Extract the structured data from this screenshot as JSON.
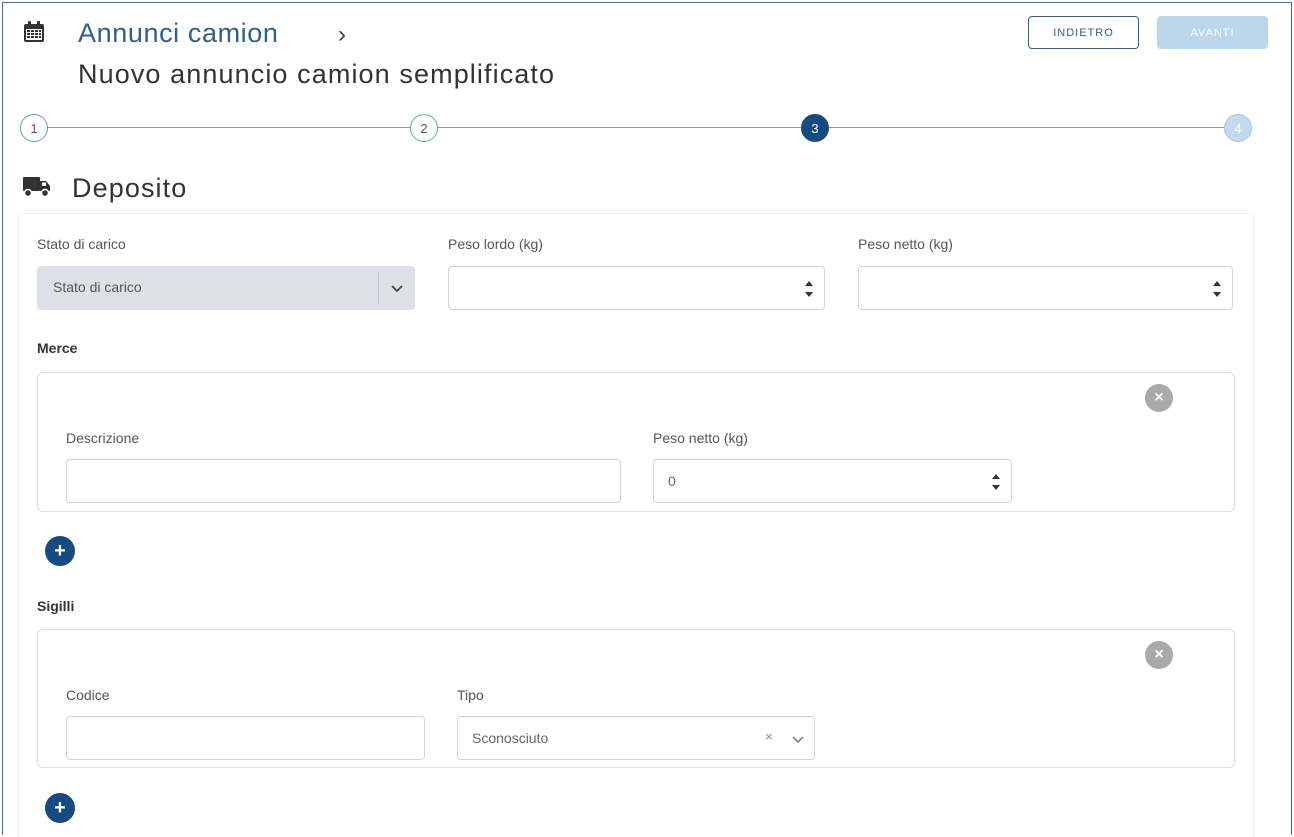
{
  "header": {
    "breadcrumb_label": "Annunci camion",
    "breadcrumb_separator": "›",
    "page_title": "Nuovo annuncio camion semplificato",
    "back_label": "INDIETRO",
    "next_label": "AVANTI"
  },
  "stepper": {
    "steps": [
      "1",
      "2",
      "3",
      "4"
    ],
    "current_step": 3
  },
  "section": {
    "title": "Deposito"
  },
  "form": {
    "stato_label": "Stato di carico",
    "stato_value": "Stato di carico",
    "peso_lordo_label": "Peso lordo (kg)",
    "peso_lordo_value": "",
    "peso_netto_label": "Peso netto (kg)",
    "peso_netto_value": ""
  },
  "merce": {
    "title": "Merce",
    "items": [
      {
        "descrizione_label": "Descrizione",
        "descrizione_value": "",
        "peso_label": "Peso netto (kg)",
        "peso_value": "0"
      }
    ]
  },
  "sigilli": {
    "title": "Sigilli",
    "items": [
      {
        "codice_label": "Codice",
        "codice_value": "",
        "tipo_label": "Tipo",
        "tipo_value": "Sconosciuto",
        "clear_icon": "×"
      }
    ]
  },
  "colors": {
    "primary": "#184a82",
    "link": "#2f5f8f",
    "disabled_button": "#bcd6ec",
    "remove_icon": "#a9a9a9"
  },
  "icons": {
    "header": "calendar-icon",
    "section": "truck-icon",
    "select": "chevron-down-icon",
    "spinner": "spinner-arrows-icon",
    "remove": "close-circle-icon",
    "add": "plus-circle-icon"
  }
}
